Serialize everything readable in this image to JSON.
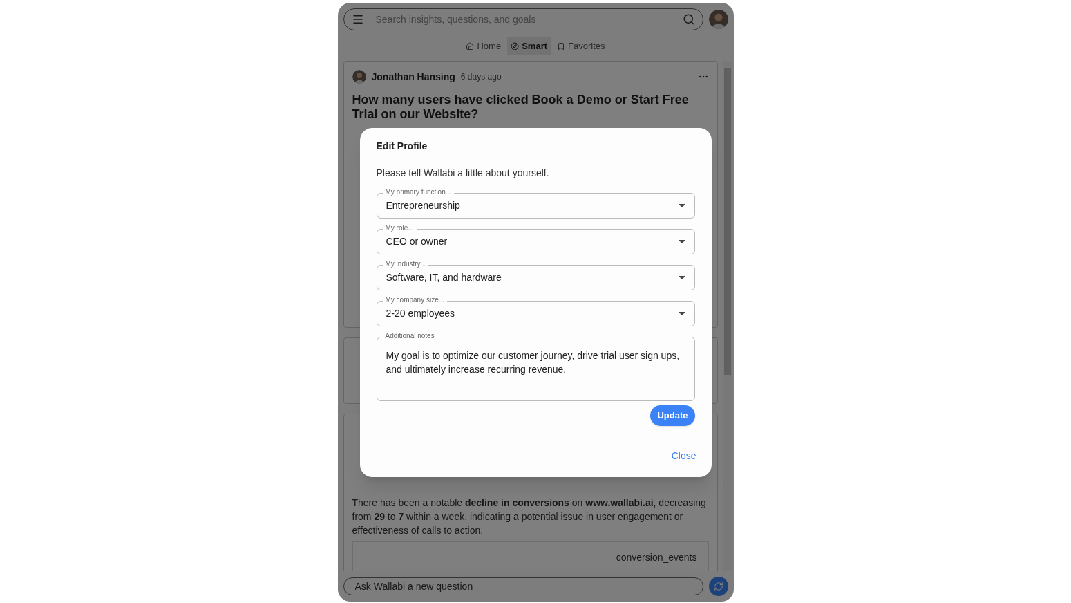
{
  "search": {
    "placeholder": "Search insights, questions, and goals"
  },
  "nav": [
    {
      "label": "Home",
      "selected": false
    },
    {
      "label": "Smart",
      "selected": true
    },
    {
      "label": "Favorites",
      "selected": false
    }
  ],
  "feed_card": {
    "author": "Jonathan Hansing",
    "time": "6 days ago",
    "title": "How many users have clicked Book a Demo or Start Free Trial on our Website?"
  },
  "insight": {
    "text": "There has been a notable **decline in conversions** on **www.wallabi.ai**, decreasing from **29** to **7** within a week, indicating a potential issue in user engagement or effectiveness of calls to action.",
    "table_header": "conversion_events"
  },
  "ask": {
    "placeholder": "Ask Wallabi a new question"
  },
  "modal": {
    "title": "Edit Profile",
    "intro": "Please tell Wallabi a little about yourself.",
    "fields": [
      {
        "label": "My primary function...",
        "value": "Entrepreneurship"
      },
      {
        "label": "My role...",
        "value": "CEO or owner"
      },
      {
        "label": "My industry...",
        "value": "Software, IT, and hardware"
      },
      {
        "label": "My company size...",
        "value": "2-20 employees"
      }
    ],
    "notes": {
      "label": "Additional notes",
      "value": "My goal is to optimize our customer journey, drive trial user sign ups, and ultimately increase recurring revenue."
    },
    "update": "Update",
    "close": "Close"
  }
}
